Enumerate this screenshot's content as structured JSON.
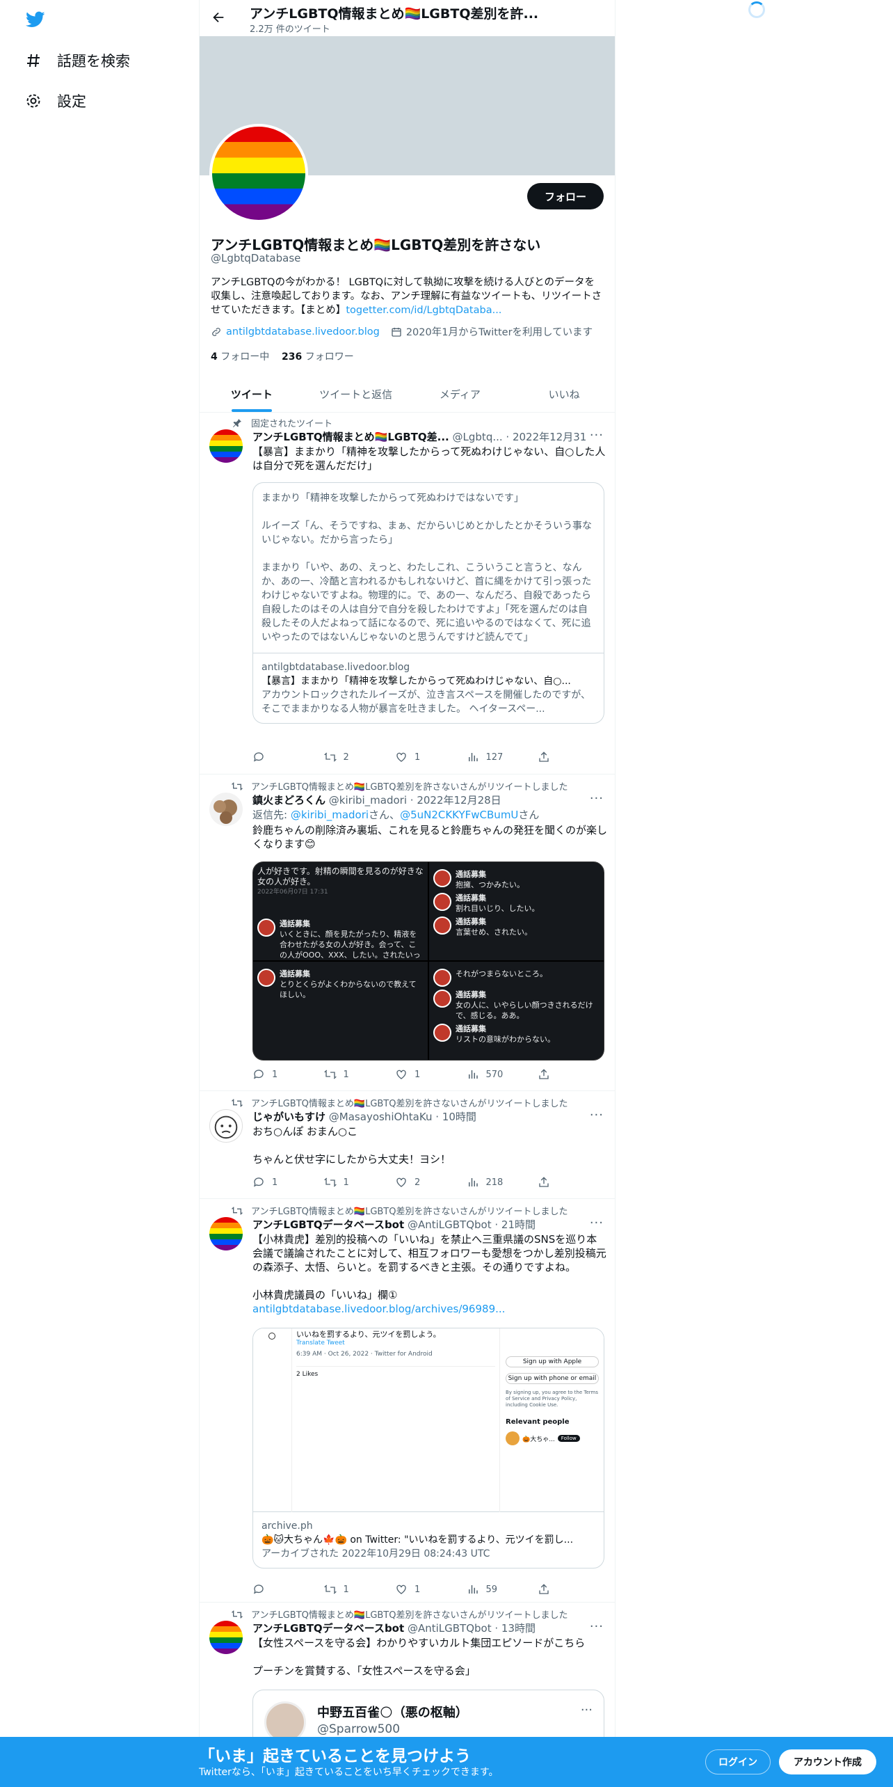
{
  "nav": {
    "explore_label": "話題を検索",
    "settings_label": "設定"
  },
  "profile": {
    "header_title": "アンチLGBTQ情報まとめ🏳️‍🌈LGBTQ差別を許...",
    "tweet_count": "2.2万 件のツイート",
    "name": "アンチLGBTQ情報まとめ🏳️‍🌈LGBTQ差別を許さない",
    "handle": "@LgbtqDatabase",
    "follow_label": "フォロー",
    "bio": "アンチLGBTQの今がわかる！ LGBTQに対して執拗に攻撃を続ける人びとのデータを収集し、注意喚起しております。なお、アンチ理解に有益なツイートも、リツイートさせていただきます。【まとめ】",
    "bio_link": "togetter.com/id/LgbtqDataba...",
    "website": "antilgbtdatabase.livedoor.blog",
    "joined": "2020年1月からTwitterを利用しています",
    "following_count": "4",
    "following_label": " フォロー中",
    "followers_count": "236",
    "followers_label": " フォロワー"
  },
  "tabs": [
    "ツイート",
    "ツイートと返信",
    "メディア",
    "いいね"
  ],
  "tweets": [
    {
      "context": "固定されたツイート",
      "name": "アンチLGBTQ情報まとめ🏳️‍🌈LGBTQ差...",
      "handle": "@Lgbtq...",
      "date": "· 2022年12月31日",
      "text": "【暴言】ままかり「精神を攻撃したからって死ぬわけじゃない、自○した人は自分で死を選んだだけ」",
      "quote": "ままかり「精神を攻撃したからって死ぬわけではないです」\n\nルイーズ「ん、そうですね、まぁ、だからいじめとかしたとかそういう事ないじゃない。だから言ったら」\n\nままかり「いや、あの、えっと、わたしこれ、こういうこと言うと、なんか、あの一、冷酷と言われるかもしれないけど、首に縄をかけて引っ張ったわけじゃないですよね。物理的に。で、あの一、なんだろ、自殺であったら自殺したのはその人は自分で自分を殺したわけですよ」「死を選んだのは自殺したその人だよねって話になるので、死に追いやるのではなくて、死に追いやったのではないんじゃないのと思うんですけど読んでて」",
      "card_domain": "antilgbtdatabase.livedoor.blog",
      "card_title": "【暴言】ままかり「精神を攻撃したからって死ぬわけじゃない、自○...",
      "card_desc": "アカウントロックされたルイーズが、泣き言スペースを開催したのですが、そこでままかりなる人物が暴言を吐きました。 ヘイタースペー...",
      "reply": "",
      "retweet": "2",
      "like": "1",
      "views": "127"
    },
    {
      "context": "アンチLGBTQ情報まとめ🏳️‍🌈LGBTQ差別を許さないさんがリツイートしました",
      "name": "鎮火まどろくん",
      "handle": "@kiribi_madori",
      "date": "· 2022年12月28日",
      "reply_to_prefix": "返信先: ",
      "reply_to_1": "@kiribi_madori",
      "reply_to_mid": "さん、",
      "reply_to_2": "@5uN2CKKYFwCBumU",
      "reply_to_suffix": "さん",
      "text": "鈴鹿ちゃんの削除済み裏垢、これを見ると鈴鹿ちゃんの発狂を聞くのが楽しくなります😊",
      "img1_text": "人が好きです。射精の瞬間を見るのが好きな女の人が好き。",
      "img1_date": "2022年06月07日 17:31",
      "img_user": "通話募集",
      "img_lines": [
        "抱擁、つかみたい。",
        "割れ目いじり、したい。",
        "言葉せめ、されたい。",
        "それがつまらないところ。",
        "女の人に、いやらしい顔つきされるだけで、感じる。ああ。",
        "リストの意味がわからない。",
        "いくときに、顔を見たがったり、精液を合わせたがる女の人が好き。会って、この人がOOO、XXX、したい。されたいって思った人か。",
        "とりとくらがよくわからないので教えてほしい。"
      ],
      "reply": "1",
      "retweet": "1",
      "like": "1",
      "views": "570"
    },
    {
      "context": "アンチLGBTQ情報まとめ🏳️‍🌈LGBTQ差別を許さないさんがリツイートしました",
      "name": "じゃがいもすけ",
      "handle": "@MasayoshiOhtaKu",
      "date": "· 10時間",
      "text": "おち○んぽ おまん○こ\n\nちゃんと伏せ字にしたから大丈夫！ヨシ！",
      "reply": "1",
      "retweet": "1",
      "like": "2",
      "views": "218"
    },
    {
      "context": "アンチLGBTQ情報まとめ🏳️‍🌈LGBTQ差別を許さないさんがリツイートしました",
      "name": "アンチLGBTQデータベースbot",
      "handle": "@AntiLGBTQbot",
      "date": "· 21時間",
      "text": "【小林貴虎】差別的投稿への「いいね」を禁止へ三重県議のSNSを巡り本会議で議論されたことに対して、相互フォロワーも愛想をつかし差別投稿元の森添子、太悟、らいと。を罰するべきと主張。その通りですよね。\n\n小林貴虎議員の「いいね」欄①",
      "link": "antilgbtdatabase.livedoor.blog/archives/96989...",
      "shot_top": "いいねを罰するより、元ツイを罰しよう。",
      "shot_translate": "Translate Tweet",
      "shot_time": "6:39 AM · Oct 26, 2022 · Twitter for Android",
      "shot_likes": "2 Likes",
      "shot_apple": "Sign up with Apple",
      "shot_phone": "Sign up with phone or email",
      "shot_terms": "By signing up, you agree to the Terms of Service and Privacy Policy, including Cookie Use.",
      "shot_relevant": "Relevant people",
      "shot_follow": "Follow",
      "shot_person_name": "🎃大ちゃ...",
      "card_domain": "archive.ph",
      "card_title": "🎃🐱大ちゃん🍁🎃 on Twitter: \"いいねを罰するより、元ツイを罰し...",
      "card_desc": "アーカイブされた 2022年10月29日 08:24:43 UTC",
      "reply": "",
      "retweet": "1",
      "like": "1",
      "views": "59"
    },
    {
      "context": "アンチLGBTQ情報まとめ🏳️‍🌈LGBTQ差別を許さないさんがリツイートしました",
      "name": "アンチLGBTQデータベースbot",
      "handle": "@AntiLGBTQbot",
      "date": "· 13時間",
      "text": "【女性スペースを守る会】わかりやすいカルト集団エピソードがこちら\n\nプーチンを賞賛する、「女性スペースを守る会」",
      "embed_name": "中野五百雀🌕（悪の枢軸）",
      "embed_handle": "@Sparrow500"
    }
  ],
  "bottom_bar": {
    "headline": "「いま」起きていることを見つけよう",
    "sub": "Twitterなら、「いま」起きていることをいち早くチェックできます。",
    "login": "ログイン",
    "signup": "アカウント作成"
  },
  "colors": {
    "accent": "#1d9bf0",
    "text": "#0f1419",
    "muted": "#536471"
  }
}
